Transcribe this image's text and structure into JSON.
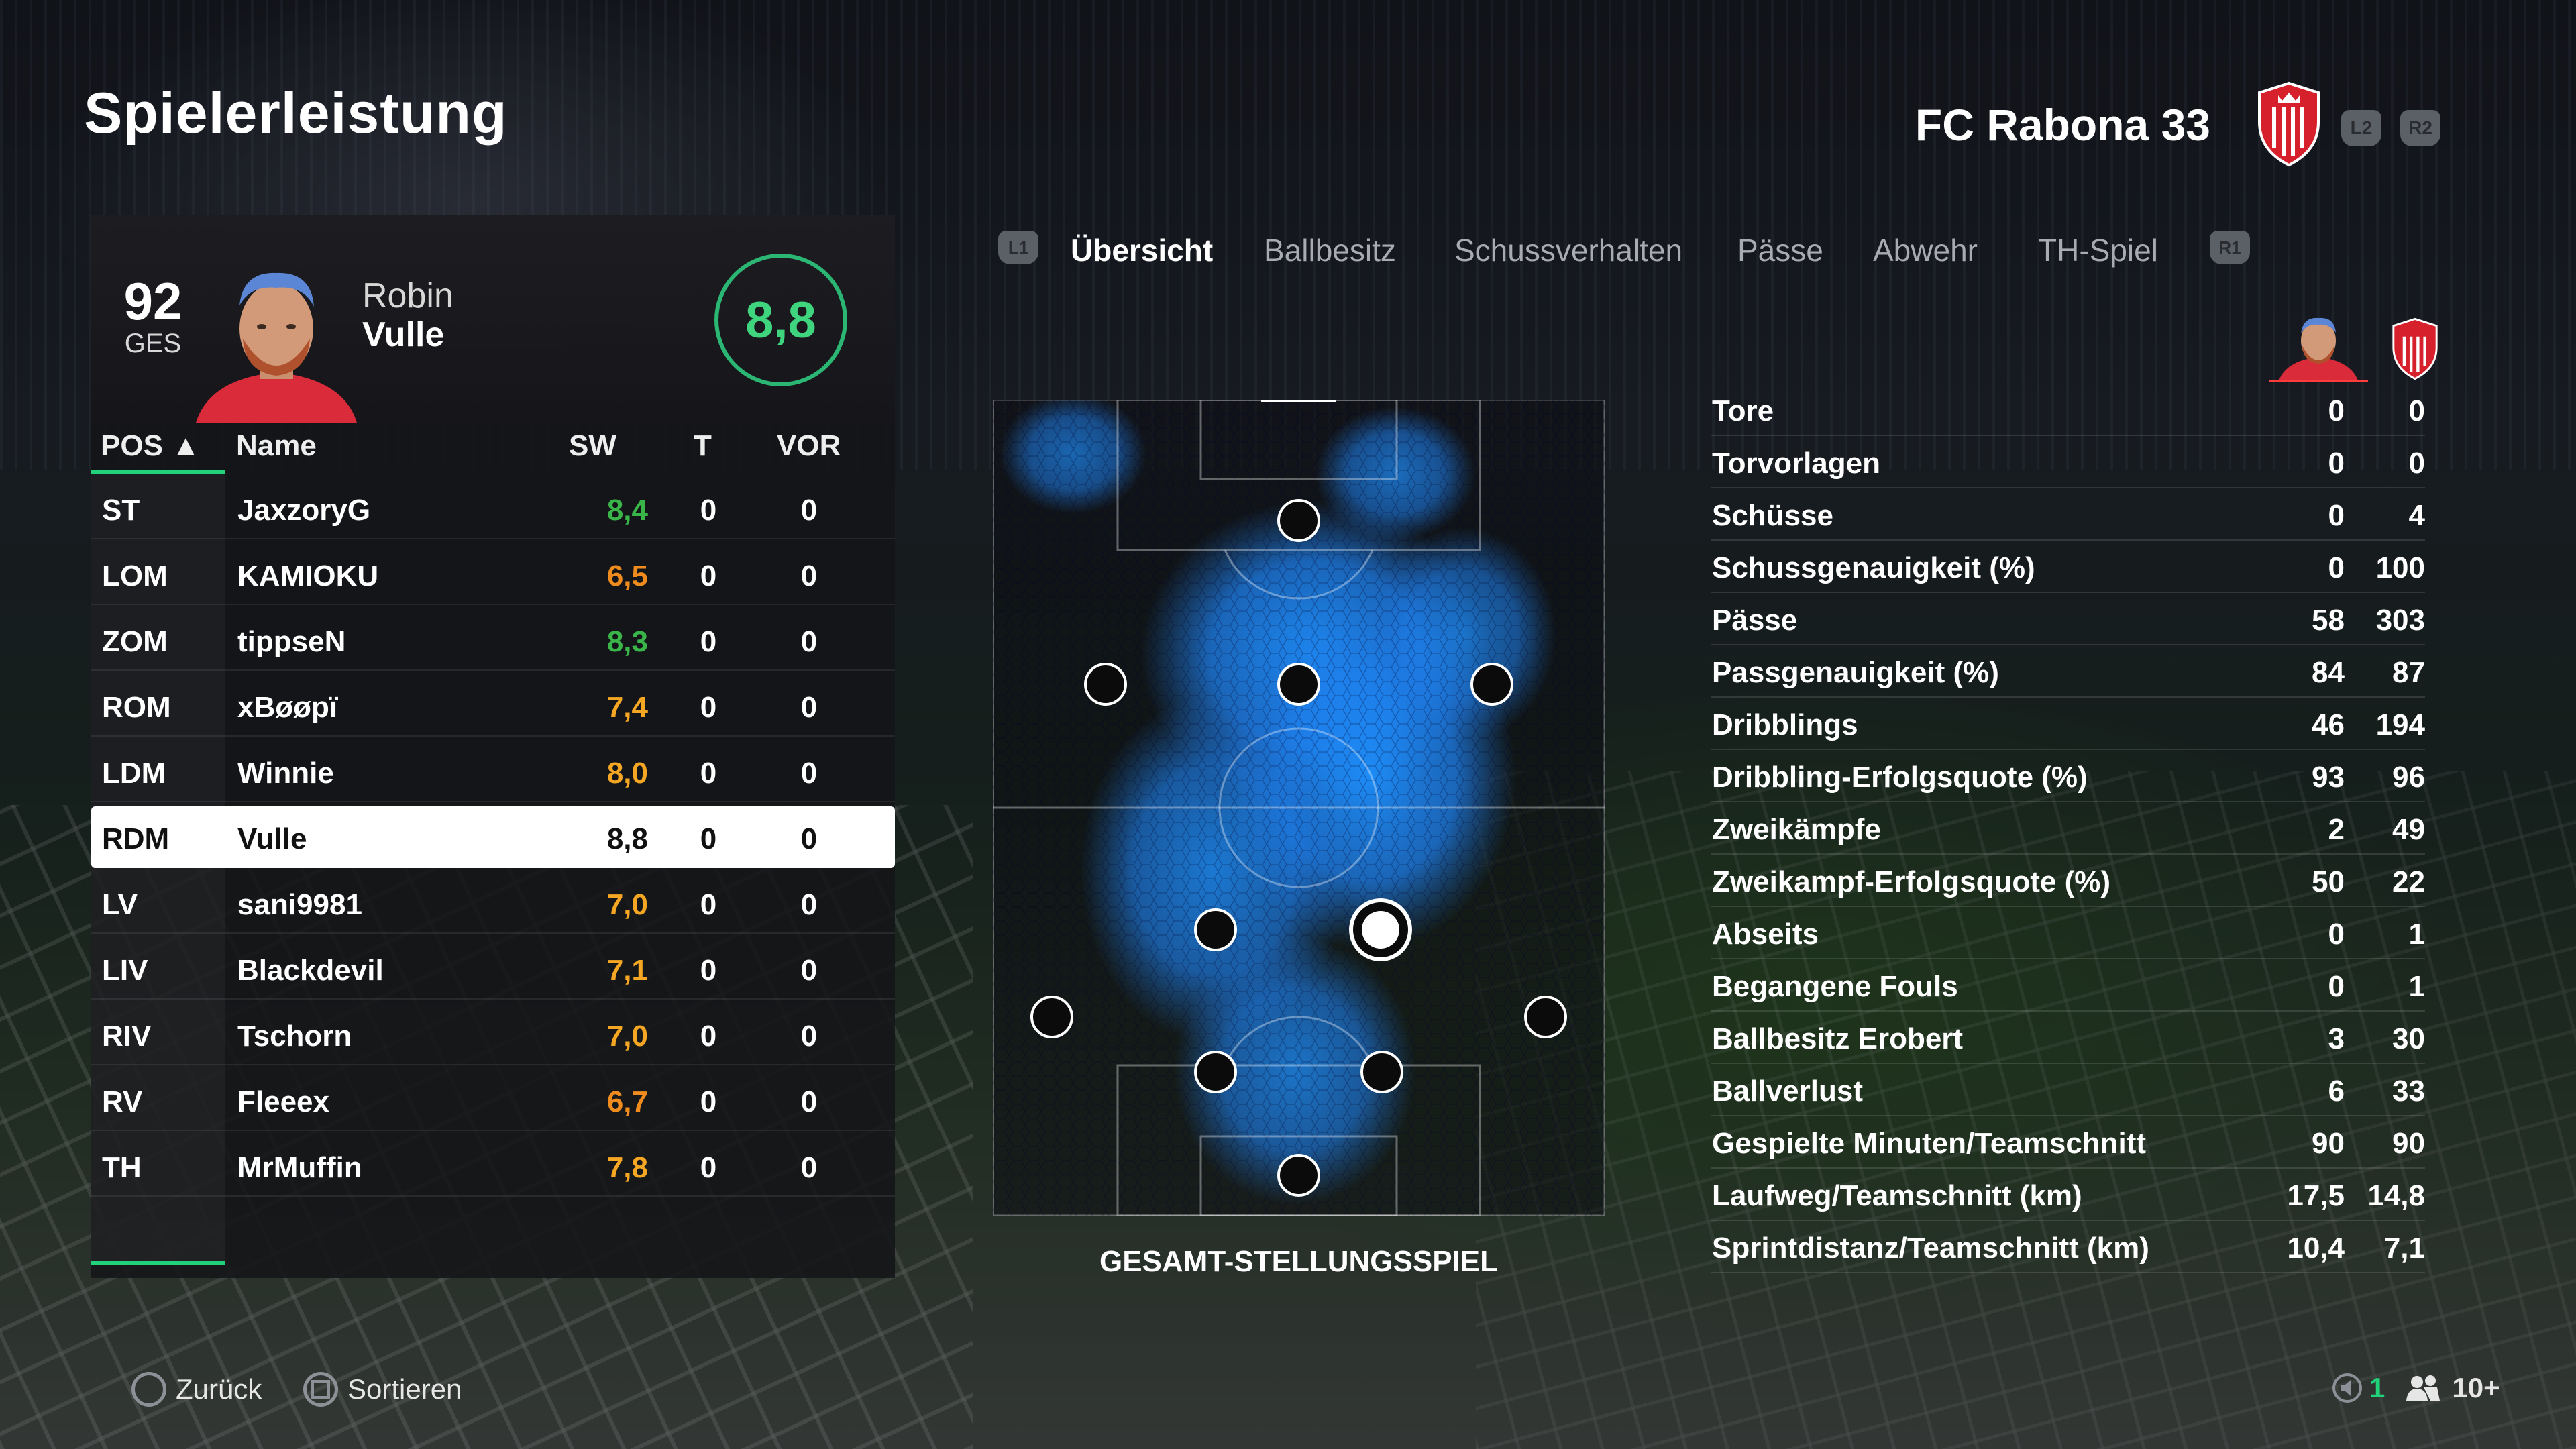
{
  "header": {
    "title": "Spielerleistung",
    "team_name": "FC Rabona 33",
    "l2": "L2",
    "r2": "R2"
  },
  "player": {
    "overall": "92",
    "overall_label": "GES",
    "first_name": "Robin",
    "last_name": "Vulle",
    "match_rating": "8,8"
  },
  "table": {
    "headers": {
      "pos": "POS ▲",
      "name": "Name",
      "sw": "SW",
      "t": "T",
      "vor": "VOR"
    },
    "rows": [
      {
        "pos": "ST",
        "name": "JaxzoryG",
        "sw": "8,4",
        "t": "0",
        "vor": "0",
        "sw_color": "#3ab54a"
      },
      {
        "pos": "LOM",
        "name": "KAMIOKU",
        "sw": "6,5",
        "t": "0",
        "vor": "0",
        "sw_color": "#f08c1e"
      },
      {
        "pos": "ZOM",
        "name": "tippseN",
        "sw": "8,3",
        "t": "0",
        "vor": "0",
        "sw_color": "#3ab54a"
      },
      {
        "pos": "ROM",
        "name": "xBøøpï",
        "sw": "7,4",
        "t": "0",
        "vor": "0",
        "sw_color": "#f5a623"
      },
      {
        "pos": "LDM",
        "name": "Winnie",
        "sw": "8,0",
        "t": "0",
        "vor": "0",
        "sw_color": "#f5a623"
      },
      {
        "pos": "RDM",
        "name": "Vulle",
        "sw": "8,8",
        "t": "0",
        "vor": "0",
        "sw_color": "#111111",
        "selected": true
      },
      {
        "pos": "LV",
        "name": "sani9981",
        "sw": "7,0",
        "t": "0",
        "vor": "0",
        "sw_color": "#f5a623"
      },
      {
        "pos": "LIV",
        "name": "Blackdevil",
        "sw": "7,1",
        "t": "0",
        "vor": "0",
        "sw_color": "#f5a623"
      },
      {
        "pos": "RIV",
        "name": "Tschorn",
        "sw": "7,0",
        "t": "0",
        "vor": "0",
        "sw_color": "#f5a623"
      },
      {
        "pos": "RV",
        "name": "Fleeex",
        "sw": "6,7",
        "t": "0",
        "vor": "0",
        "sw_color": "#f08c1e"
      },
      {
        "pos": "TH",
        "name": "MrMuffin",
        "sw": "7,8",
        "t": "0",
        "vor": "0",
        "sw_color": "#f5a623"
      }
    ]
  },
  "tabs": {
    "l1": "L1",
    "r1": "R1",
    "items": [
      "Übersicht",
      "Ballbesitz",
      "Schussverhalten",
      "Pässe",
      "Abwehr",
      "TH-Spiel"
    ],
    "active": "Übersicht"
  },
  "pitch": {
    "caption": "GESAMT-STELLUNGSSPIEL",
    "heat_color": "#1e90ff"
  },
  "stats": [
    {
      "label": "Tore",
      "player": "0",
      "team": "0"
    },
    {
      "label": "Torvorlagen",
      "player": "0",
      "team": "0"
    },
    {
      "label": "Schüsse",
      "player": "0",
      "team": "4"
    },
    {
      "label": "Schussgenauigkeit (%)",
      "player": "0",
      "team": "100"
    },
    {
      "label": "Pässe",
      "player": "58",
      "team": "303"
    },
    {
      "label": "Passgenauigkeit (%)",
      "player": "84",
      "team": "87"
    },
    {
      "label": "Dribblings",
      "player": "46",
      "team": "194"
    },
    {
      "label": "Dribbling-Erfolgsquote (%)",
      "player": "93",
      "team": "96"
    },
    {
      "label": "Zweikämpfe",
      "player": "2",
      "team": "49"
    },
    {
      "label": "Zweikampf-Erfolgsquote (%)",
      "player": "50",
      "team": "22"
    },
    {
      "label": "Abseits",
      "player": "0",
      "team": "1"
    },
    {
      "label": "Begangene Fouls",
      "player": "0",
      "team": "1"
    },
    {
      "label": "Ballbesitz Erobert",
      "player": "3",
      "team": "30"
    },
    {
      "label": "Ballverlust",
      "player": "6",
      "team": "33"
    },
    {
      "label": "Gespielte Minuten/Teamschnitt",
      "player": "90",
      "team": "90"
    },
    {
      "label": "Laufweg/Teamschnitt (km)",
      "player": "17,5",
      "team": "14,8"
    },
    {
      "label": "Sprintdistanz/Teamschnitt (km)",
      "player": "10,4",
      "team": "7,1"
    }
  ],
  "footer": {
    "back": "Zurück",
    "sort": "Sortieren",
    "mic_count": "1",
    "party_count": "10+"
  },
  "colors": {
    "accent_green": "#22d27a",
    "rating_green": "#3fd47e",
    "crest_red": "#d6202b"
  }
}
